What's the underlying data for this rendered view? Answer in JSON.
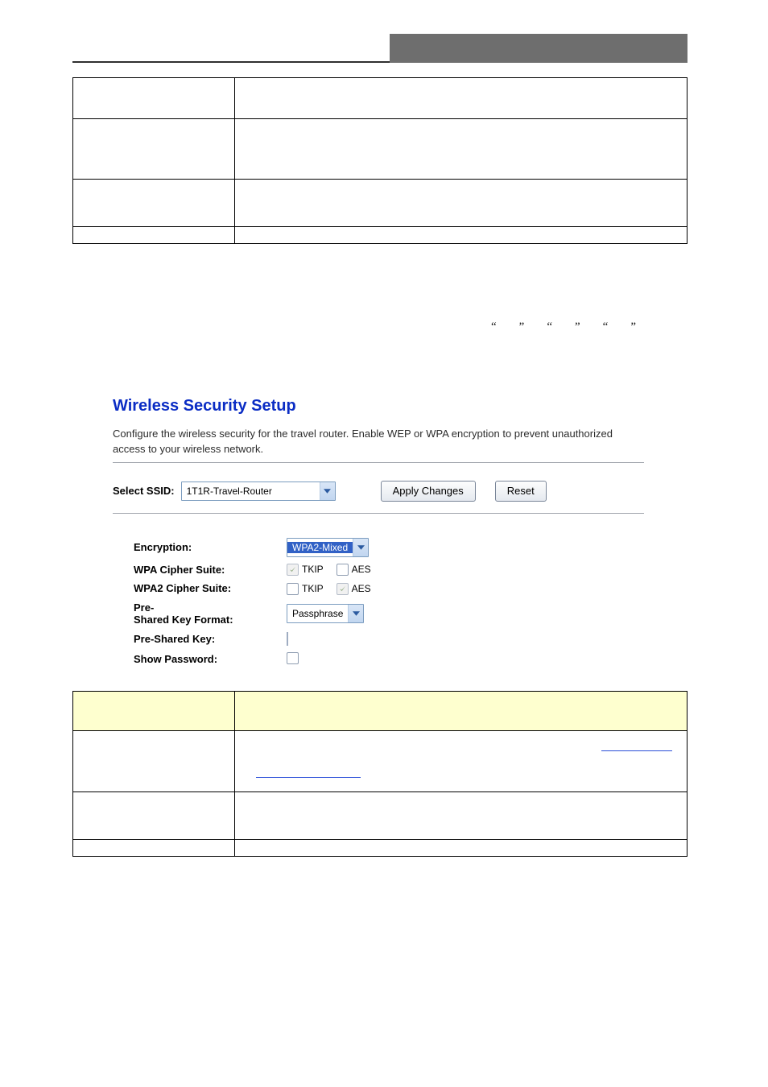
{
  "table1": {
    "rows": [
      {
        "label": "",
        "desc": ""
      },
      {
        "label": "",
        "desc": ""
      },
      {
        "label": "",
        "desc": ""
      },
      {
        "label": "",
        "desc": ""
      }
    ]
  },
  "mid_paragraph": "",
  "quote_tokens": [
    "“",
    "”",
    "“",
    "”",
    "“",
    "”"
  ],
  "shot": {
    "heading": "Wireless Security Setup",
    "desc": "Configure the wireless security for the travel router. Enable WEP or WPA encryption to prevent unauthorized access to your wireless network.",
    "select_ssid_label": "Select SSID:",
    "ssid_value": "1T1R-Travel-Router",
    "apply_label": "Apply Changes",
    "reset_label": "Reset",
    "form": {
      "encryption_label": "Encryption:",
      "encryption_value": "WPA2-Mixed",
      "wpa_cipher_label": "WPA Cipher Suite:",
      "wpa_tkip": "TKIP",
      "wpa_aes": "AES",
      "wpa2_cipher_label": "WPA2 Cipher Suite:",
      "wpa2_tkip": "TKIP",
      "wpa2_aes": "AES",
      "psk_format_label": "Pre-\nShared Key Format:",
      "psk_format_value": "Passphrase",
      "psk_label": "Pre-Shared Key:",
      "psk_value": "",
      "show_pw_label": "Show Password:"
    },
    "checkbox_state": {
      "wpa_tkip": {
        "checked": true,
        "disabled": true
      },
      "wpa_aes": {
        "checked": false,
        "disabled": false
      },
      "wpa2_tkip": {
        "checked": false,
        "disabled": false
      },
      "wpa2_aes": {
        "checked": true,
        "disabled": true
      },
      "show_pw": {
        "checked": false,
        "disabled": false
      }
    }
  },
  "table2": {
    "header": {
      "label": "",
      "desc": ""
    },
    "rows": [
      {
        "label": "",
        "desc": ""
      },
      {
        "label": "",
        "desc": ""
      },
      {
        "label": "",
        "desc": ""
      }
    ]
  }
}
